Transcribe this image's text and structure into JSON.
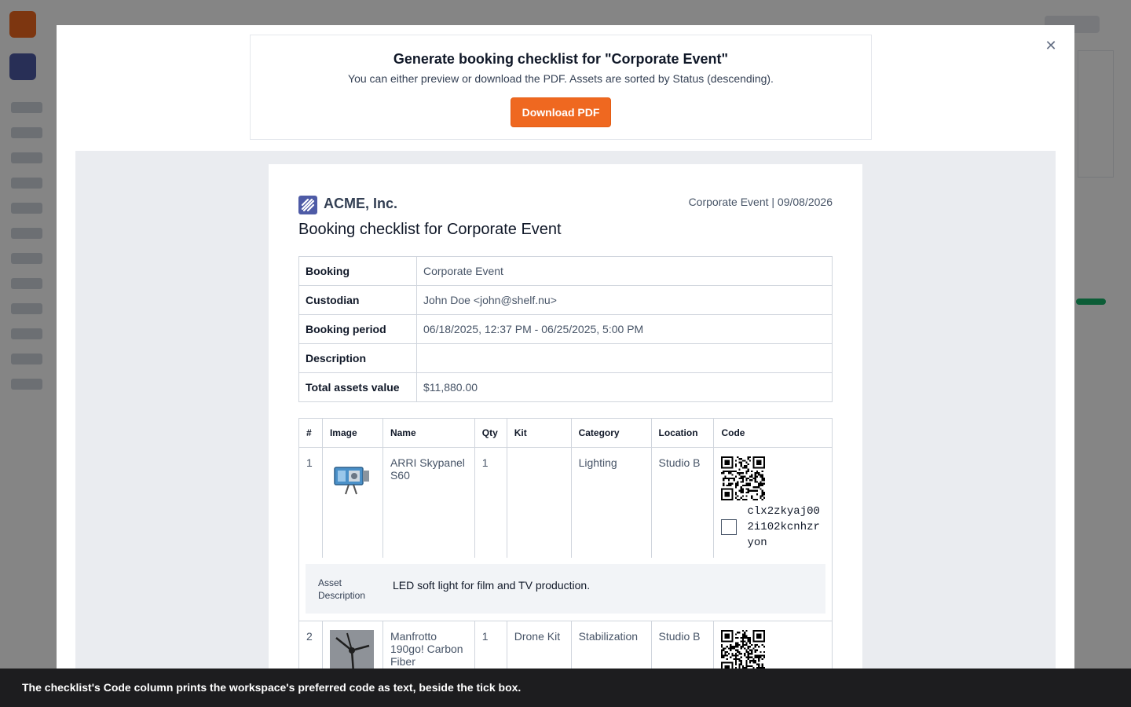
{
  "modal": {
    "title": "Generate booking checklist for \"Corporate Event\"",
    "subtitle": "You can either preview or download the PDF. Assets are sorted by Status (descending).",
    "download_label": "Download PDF",
    "close_icon": "close-icon"
  },
  "document": {
    "org_name": "ACME, Inc.",
    "meta": "Corporate Event | 09/08/2026",
    "title": "Booking checklist for Corporate Event",
    "info_rows": [
      {
        "label": "Booking",
        "value": "Corporate Event"
      },
      {
        "label": "Custodian",
        "value": "John Doe <john@shelf.nu>"
      },
      {
        "label": "Booking period",
        "value": "06/18/2025, 12:37 PM - 06/25/2025, 5:00 PM"
      },
      {
        "label": "Description",
        "value": ""
      },
      {
        "label": "Total assets value",
        "value": "$11,880.00"
      }
    ],
    "columns": [
      "#",
      "Image",
      "Name",
      "Qty",
      "Kit",
      "Category",
      "Location",
      "Code"
    ],
    "assets": [
      {
        "num": "1",
        "name": "ARRI Skypanel S60",
        "qty": "1",
        "kit": "",
        "category": "Lighting",
        "location": "Studio B",
        "code": "clx2zkyaj002i102kcnhzryon",
        "description_label": "Asset Description",
        "description": "LED soft light for film and TV production."
      },
      {
        "num": "2",
        "name": "Manfrotto 190go! Carbon Fiber",
        "qty": "1",
        "kit": "Drone Kit",
        "category": "Stabilization",
        "location": "Studio B"
      }
    ]
  },
  "toast": {
    "message": "The checklist's Code column prints the workspace's preferred code as text, beside the tick box."
  },
  "colors": {
    "accent": "#ef6820",
    "brand": "#4e5ba6"
  }
}
